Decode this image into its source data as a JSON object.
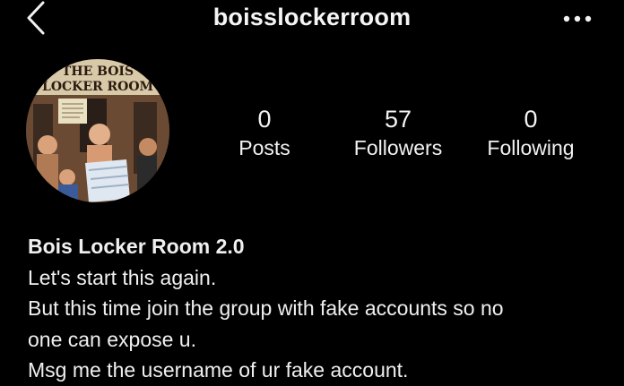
{
  "header": {
    "username": "boisslockerroom",
    "back_icon": "chevron-left-icon",
    "more_icon": "more-dots-icon"
  },
  "profile": {
    "avatar_icon": "profile-avatar-cartoon",
    "avatar_text": "THE BOIS LOCKER ROOM",
    "stats": {
      "posts": {
        "value": "0",
        "label": "Posts"
      },
      "followers": {
        "value": "57",
        "label": "Followers"
      },
      "following": {
        "value": "0",
        "label": "Following"
      }
    },
    "bio": {
      "name": "Bois Locker Room 2.0",
      "lines": [
        "Let's start this again.",
        "But this time join the group with fake accounts so no",
        "one can expose u.",
        "Msg me the username of ur fake account."
      ]
    }
  },
  "colors": {
    "background": "#000000",
    "text": "#f2f2f2"
  }
}
